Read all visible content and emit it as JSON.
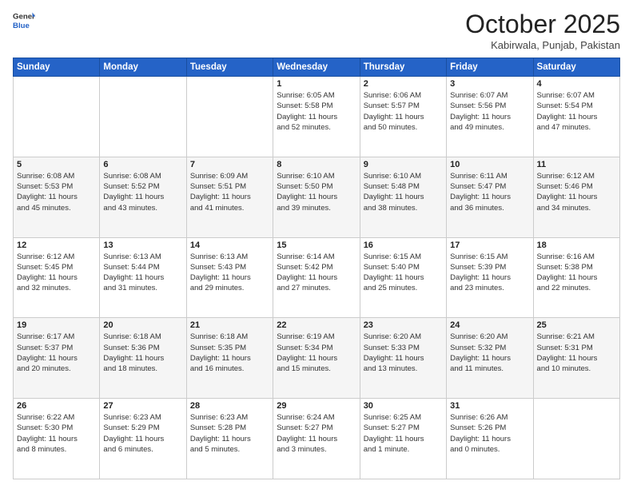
{
  "header": {
    "logo_general": "General",
    "logo_blue": "Blue",
    "month_title": "October 2025",
    "location": "Kabirwala, Punjab, Pakistan"
  },
  "weekdays": [
    "Sunday",
    "Monday",
    "Tuesday",
    "Wednesday",
    "Thursday",
    "Friday",
    "Saturday"
  ],
  "weeks": [
    [
      {
        "day": "",
        "info": ""
      },
      {
        "day": "",
        "info": ""
      },
      {
        "day": "",
        "info": ""
      },
      {
        "day": "1",
        "info": "Sunrise: 6:05 AM\nSunset: 5:58 PM\nDaylight: 11 hours\nand 52 minutes."
      },
      {
        "day": "2",
        "info": "Sunrise: 6:06 AM\nSunset: 5:57 PM\nDaylight: 11 hours\nand 50 minutes."
      },
      {
        "day": "3",
        "info": "Sunrise: 6:07 AM\nSunset: 5:56 PM\nDaylight: 11 hours\nand 49 minutes."
      },
      {
        "day": "4",
        "info": "Sunrise: 6:07 AM\nSunset: 5:54 PM\nDaylight: 11 hours\nand 47 minutes."
      }
    ],
    [
      {
        "day": "5",
        "info": "Sunrise: 6:08 AM\nSunset: 5:53 PM\nDaylight: 11 hours\nand 45 minutes."
      },
      {
        "day": "6",
        "info": "Sunrise: 6:08 AM\nSunset: 5:52 PM\nDaylight: 11 hours\nand 43 minutes."
      },
      {
        "day": "7",
        "info": "Sunrise: 6:09 AM\nSunset: 5:51 PM\nDaylight: 11 hours\nand 41 minutes."
      },
      {
        "day": "8",
        "info": "Sunrise: 6:10 AM\nSunset: 5:50 PM\nDaylight: 11 hours\nand 39 minutes."
      },
      {
        "day": "9",
        "info": "Sunrise: 6:10 AM\nSunset: 5:48 PM\nDaylight: 11 hours\nand 38 minutes."
      },
      {
        "day": "10",
        "info": "Sunrise: 6:11 AM\nSunset: 5:47 PM\nDaylight: 11 hours\nand 36 minutes."
      },
      {
        "day": "11",
        "info": "Sunrise: 6:12 AM\nSunset: 5:46 PM\nDaylight: 11 hours\nand 34 minutes."
      }
    ],
    [
      {
        "day": "12",
        "info": "Sunrise: 6:12 AM\nSunset: 5:45 PM\nDaylight: 11 hours\nand 32 minutes."
      },
      {
        "day": "13",
        "info": "Sunrise: 6:13 AM\nSunset: 5:44 PM\nDaylight: 11 hours\nand 31 minutes."
      },
      {
        "day": "14",
        "info": "Sunrise: 6:13 AM\nSunset: 5:43 PM\nDaylight: 11 hours\nand 29 minutes."
      },
      {
        "day": "15",
        "info": "Sunrise: 6:14 AM\nSunset: 5:42 PM\nDaylight: 11 hours\nand 27 minutes."
      },
      {
        "day": "16",
        "info": "Sunrise: 6:15 AM\nSunset: 5:40 PM\nDaylight: 11 hours\nand 25 minutes."
      },
      {
        "day": "17",
        "info": "Sunrise: 6:15 AM\nSunset: 5:39 PM\nDaylight: 11 hours\nand 23 minutes."
      },
      {
        "day": "18",
        "info": "Sunrise: 6:16 AM\nSunset: 5:38 PM\nDaylight: 11 hours\nand 22 minutes."
      }
    ],
    [
      {
        "day": "19",
        "info": "Sunrise: 6:17 AM\nSunset: 5:37 PM\nDaylight: 11 hours\nand 20 minutes."
      },
      {
        "day": "20",
        "info": "Sunrise: 6:18 AM\nSunset: 5:36 PM\nDaylight: 11 hours\nand 18 minutes."
      },
      {
        "day": "21",
        "info": "Sunrise: 6:18 AM\nSunset: 5:35 PM\nDaylight: 11 hours\nand 16 minutes."
      },
      {
        "day": "22",
        "info": "Sunrise: 6:19 AM\nSunset: 5:34 PM\nDaylight: 11 hours\nand 15 minutes."
      },
      {
        "day": "23",
        "info": "Sunrise: 6:20 AM\nSunset: 5:33 PM\nDaylight: 11 hours\nand 13 minutes."
      },
      {
        "day": "24",
        "info": "Sunrise: 6:20 AM\nSunset: 5:32 PM\nDaylight: 11 hours\nand 11 minutes."
      },
      {
        "day": "25",
        "info": "Sunrise: 6:21 AM\nSunset: 5:31 PM\nDaylight: 11 hours\nand 10 minutes."
      }
    ],
    [
      {
        "day": "26",
        "info": "Sunrise: 6:22 AM\nSunset: 5:30 PM\nDaylight: 11 hours\nand 8 minutes."
      },
      {
        "day": "27",
        "info": "Sunrise: 6:23 AM\nSunset: 5:29 PM\nDaylight: 11 hours\nand 6 minutes."
      },
      {
        "day": "28",
        "info": "Sunrise: 6:23 AM\nSunset: 5:28 PM\nDaylight: 11 hours\nand 5 minutes."
      },
      {
        "day": "29",
        "info": "Sunrise: 6:24 AM\nSunset: 5:27 PM\nDaylight: 11 hours\nand 3 minutes."
      },
      {
        "day": "30",
        "info": "Sunrise: 6:25 AM\nSunset: 5:27 PM\nDaylight: 11 hours\nand 1 minute."
      },
      {
        "day": "31",
        "info": "Sunrise: 6:26 AM\nSunset: 5:26 PM\nDaylight: 11 hours\nand 0 minutes."
      },
      {
        "day": "",
        "info": ""
      }
    ]
  ]
}
